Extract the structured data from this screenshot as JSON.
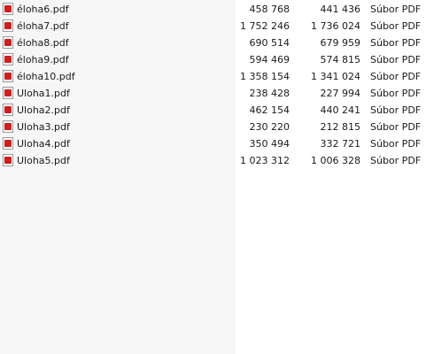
{
  "files": [
    {
      "name": "éloha6.pdf",
      "size": "458 768",
      "packed_size": "441 436",
      "type": "Súbor PDF",
      "icon": "pdf-file-icon"
    },
    {
      "name": "éloha7.pdf",
      "size": "1 752 246",
      "packed_size": "1 736 024",
      "type": "Súbor PDF",
      "icon": "pdf-file-icon"
    },
    {
      "name": "éloha8.pdf",
      "size": "690 514",
      "packed_size": "679 959",
      "type": "Súbor PDF",
      "icon": "pdf-file-icon"
    },
    {
      "name": "éloha9.pdf",
      "size": "594 469",
      "packed_size": "574 815",
      "type": "Súbor PDF",
      "icon": "pdf-file-icon"
    },
    {
      "name": "éloha10.pdf",
      "size": "1 358 154",
      "packed_size": "1 341 024",
      "type": "Súbor PDF",
      "icon": "pdf-file-icon"
    },
    {
      "name": "Uloha1.pdf",
      "size": "238 428",
      "packed_size": "227 994",
      "type": "Súbor PDF",
      "icon": "pdf-file-icon"
    },
    {
      "name": "Uloha2.pdf",
      "size": "462 154",
      "packed_size": "440 241",
      "type": "Súbor PDF",
      "icon": "pdf-file-icon"
    },
    {
      "name": "Uloha3.pdf",
      "size": "230 220",
      "packed_size": "212 815",
      "type": "Súbor PDF",
      "icon": "pdf-file-icon"
    },
    {
      "name": "Uloha4.pdf",
      "size": "350 494",
      "packed_size": "332 721",
      "type": "Súbor PDF",
      "icon": "pdf-file-icon"
    },
    {
      "name": "Uloha5.pdf",
      "size": "1 023 312",
      "packed_size": "1 006 328",
      "type": "Súbor PDF",
      "icon": "pdf-file-icon"
    }
  ]
}
